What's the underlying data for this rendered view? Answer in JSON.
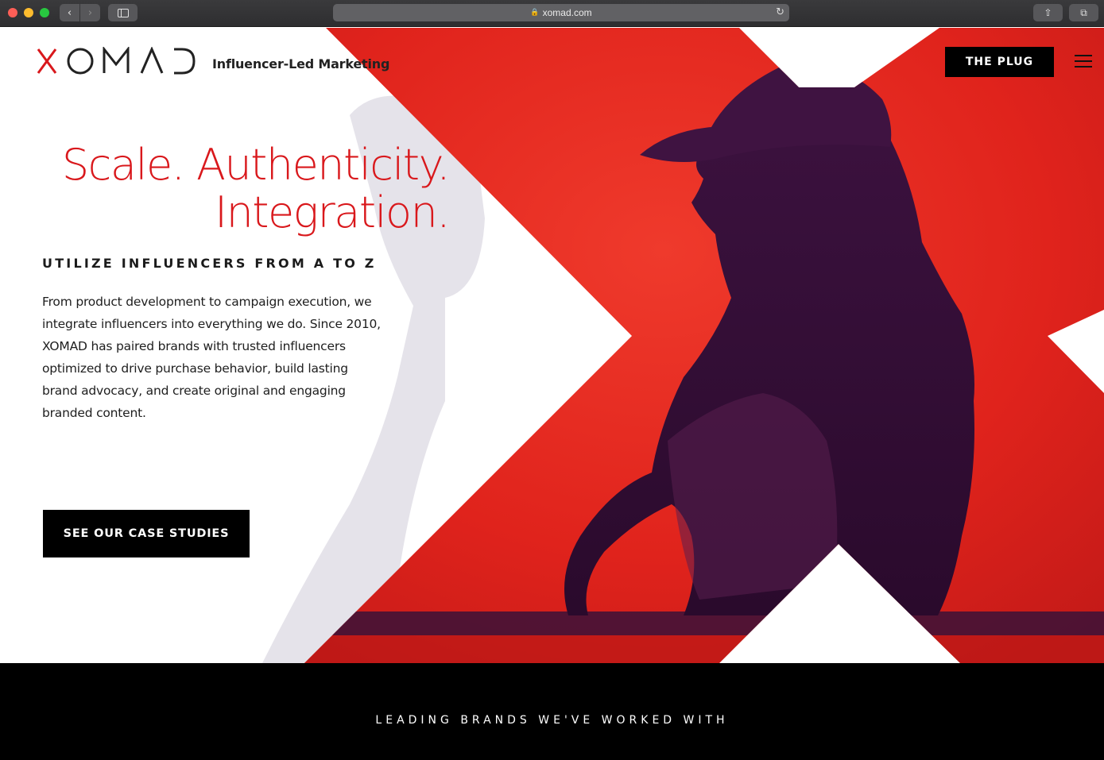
{
  "browser": {
    "url": "xomad.com",
    "back_label": "‹",
    "forward_label": "›",
    "lock_icon": "lock-icon",
    "reload_icon": "reload-icon",
    "share_icon": "share-icon",
    "tabs_icon": "tabs-icon"
  },
  "header": {
    "logo_text": "XOMAD",
    "tagline": "Influencer-Led Marketing",
    "plug_button": "THE PLUG",
    "menu_icon": "hamburger-menu-icon"
  },
  "hero": {
    "headline_line1": "Scale. Authenticity.",
    "headline_line2": "Integration.",
    "subheading": "UTILIZE INFLUENCERS FROM A TO Z",
    "body": "From product development to campaign execution, we integrate influencers into everything we do. Since 2010, XOMAD has paired brands with trusted influencers optimized to drive purchase behavior, build lasting brand advocacy, and create original and engaging branded content.",
    "cta_label": "SEE OUR CASE STUDIES"
  },
  "brands": {
    "title": "LEADING BRANDS WE'VE WORKED WITH"
  },
  "colors": {
    "brand_red": "#d9181c",
    "hero_red": "#e4261f",
    "dark_purple": "#3a1238",
    "black": "#000000"
  }
}
